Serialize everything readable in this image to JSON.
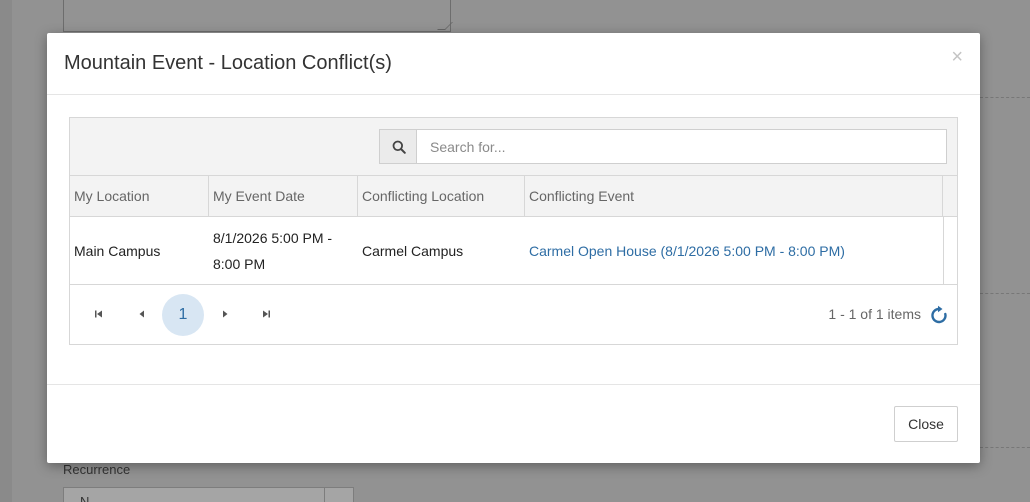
{
  "modal": {
    "title": "Mountain Event - Location Conflict(s)",
    "close_x": "×",
    "close_button": "Close"
  },
  "search": {
    "placeholder": "Search for...",
    "icon": "search-icon"
  },
  "grid": {
    "columns": [
      "My Location",
      "My Event Date",
      "Conflicting Location",
      "Conflicting Event"
    ],
    "rows": [
      {
        "my_location": "Main Campus",
        "my_event_date": "8/1/2026 5:00 PM - 8:00 PM",
        "conflicting_location": "Carmel Campus",
        "conflicting_event": "Carmel Open House (8/1/2026 5:00 PM - 8:00 PM)"
      }
    ]
  },
  "pager": {
    "current_page": "1",
    "info": "1 - 1 of 1 items",
    "icons": [
      "first-page-icon",
      "prev-page-icon",
      "next-page-icon",
      "last-page-icon",
      "refresh-icon"
    ]
  },
  "background": {
    "recurrence_label": "Recurrence",
    "recurrence_value": "N..."
  },
  "colors": {
    "accent": "#2e6da4",
    "current_page_bg": "#d8e6f3",
    "overlay": "#8a8a8a"
  }
}
